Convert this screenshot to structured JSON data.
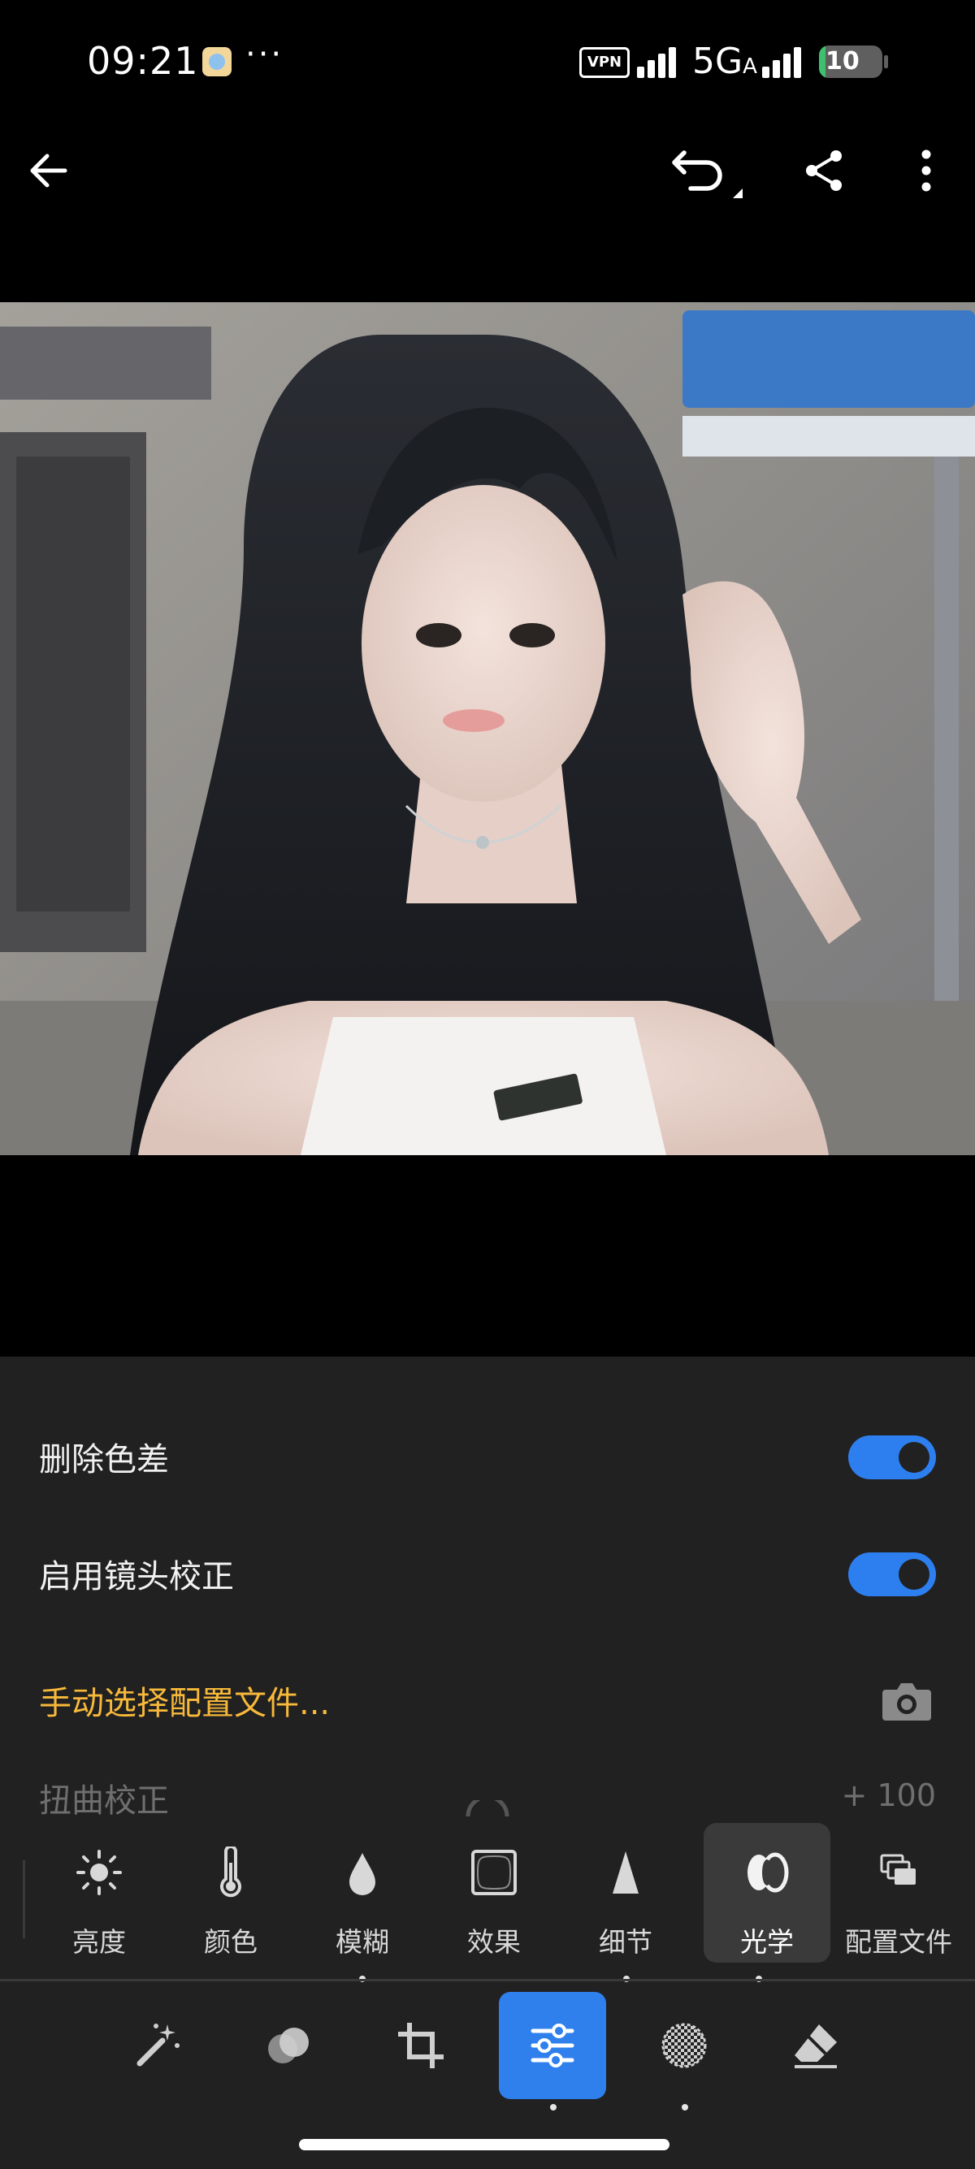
{
  "status_bar": {
    "time": "09:21",
    "more": "···",
    "vpn": "VPN",
    "network": "5G",
    "network_sub": "A",
    "battery": "10",
    "battery_fraction": 0.1
  },
  "toolbar": {
    "back_icon": "arrow-left-icon",
    "undo_icon": "undo-icon",
    "share_icon": "share-icon",
    "more_icon": "more-vertical-icon"
  },
  "photo": {
    "subject": "portrait photo of a woman with long black hair in a white top"
  },
  "optics_panel": {
    "remove_ca_label": "删除色差",
    "remove_ca_on": true,
    "lens_correction_label": "启用镜头校正",
    "lens_correction_on": true,
    "manual_profile_label": "手动选择配置文件...",
    "distortion_label": "扭曲校正",
    "distortion_value": "+ 100"
  },
  "tools": [
    {
      "label": "亮度",
      "icon": "sun-icon"
    },
    {
      "label": "颜色",
      "icon": "thermometer-icon"
    },
    {
      "label": "模糊",
      "icon": "droplet-icon"
    },
    {
      "label": "效果",
      "icon": "vignette-icon"
    },
    {
      "label": "细节",
      "icon": "triangle-icon"
    },
    {
      "label": "光学",
      "icon": "lens-icon",
      "active": true
    },
    {
      "label": "配置文件",
      "icon": "profiles-icon"
    }
  ],
  "bottom_nav": [
    {
      "icon": "magic-wand-icon"
    },
    {
      "icon": "presets-icon"
    },
    {
      "icon": "crop-icon"
    },
    {
      "icon": "sliders-icon",
      "active": true
    },
    {
      "icon": "masking-icon"
    },
    {
      "icon": "eraser-icon"
    }
  ],
  "colors": {
    "accent_blue": "#2f80ed",
    "toggle_blue": "#2d7ff0",
    "profile_yellow": "#f7b93a",
    "panel_bg": "#212121"
  }
}
